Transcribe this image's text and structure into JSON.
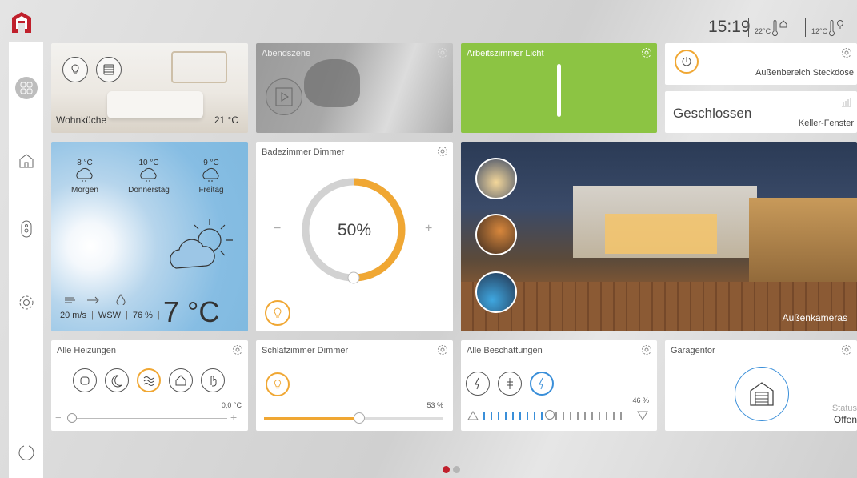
{
  "header": {
    "time": "15:19",
    "indoor_temp": "22°C",
    "outdoor_temp": "12°C"
  },
  "colors": {
    "accent_red": "#c0202c",
    "green": "#8cc443",
    "orange": "#f0a733",
    "sky": "#7fb9df"
  },
  "sidebar": {
    "items": [
      "scenes-grid-icon",
      "home-icon",
      "remote-icon",
      "settings-icon",
      "refresh-icon"
    ]
  },
  "tiles": {
    "wohnkueche": {
      "label": "Wohnküche",
      "temp": "21 °C"
    },
    "abendszene": {
      "title": "Abendszene"
    },
    "arbeitszimmer": {
      "title": "Arbeitszimmer Licht",
      "state": "on"
    },
    "steckdose": {
      "label": "Außenbereich Steckdose"
    },
    "keller": {
      "status": "Geschlossen",
      "label": "Keller-Fenster"
    },
    "weather": {
      "forecast": [
        {
          "temp": "8 °C",
          "day": "Morgen"
        },
        {
          "temp": "10 °C",
          "day": "Donnerstag"
        },
        {
          "temp": "9 °C",
          "day": "Freitag"
        }
      ],
      "wind": "20 m/s",
      "direction": "WSW",
      "humidity": "76 %",
      "temp": "7 °C"
    },
    "badezimmer": {
      "title": "Badezimmer Dimmer",
      "value": "50%",
      "level": 0.5,
      "minus": "−",
      "plus": "+"
    },
    "kameras": {
      "label": "Außenkameras"
    },
    "heizungen": {
      "title": "Alle Heizungen",
      "temp": "0,0 °C",
      "minus": "−",
      "plus": "+"
    },
    "schlafzimmer": {
      "title": "Schlafzimmer Dimmer",
      "value": "53 %",
      "level": 0.53
    },
    "beschattungen": {
      "title": "Alle Beschattungen",
      "value": "46 %",
      "level": 0.46
    },
    "garagentor": {
      "title": "Garagentor",
      "status_label": "Status",
      "status": "Offen"
    }
  },
  "pager": {
    "pages": 2,
    "active": 0
  }
}
